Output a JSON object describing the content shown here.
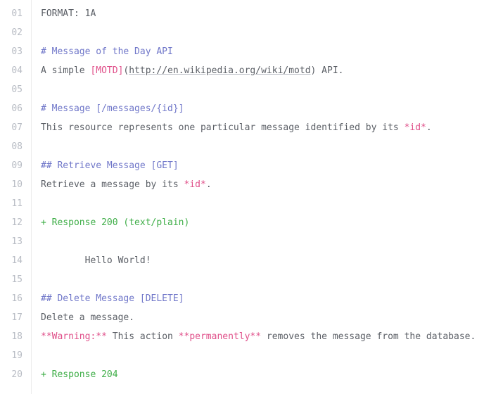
{
  "editor": {
    "lines": [
      {
        "no": "01",
        "spans": [
          {
            "t": "FORMAT: 1A",
            "c": "c-default"
          }
        ]
      },
      {
        "no": "02",
        "spans": []
      },
      {
        "no": "03",
        "spans": [
          {
            "t": "# Message of the Day API",
            "c": "c-heading"
          }
        ]
      },
      {
        "no": "04",
        "spans": [
          {
            "t": "A simple ",
            "c": "c-default"
          },
          {
            "t": "[MOTD]",
            "c": "c-link"
          },
          {
            "t": "(",
            "c": "c-default"
          },
          {
            "t": "http://en.wikipedia.org/wiki/motd",
            "c": "c-url"
          },
          {
            "t": ") API.",
            "c": "c-default"
          }
        ]
      },
      {
        "no": "05",
        "spans": []
      },
      {
        "no": "06",
        "spans": [
          {
            "t": "# Message [/messages/{id}]",
            "c": "c-heading"
          }
        ]
      },
      {
        "no": "07",
        "spans": [
          {
            "t": "This resource represents one particular message identified by its ",
            "c": "c-default"
          },
          {
            "t": "*id*",
            "c": "c-emph"
          },
          {
            "t": ".",
            "c": "c-default"
          }
        ]
      },
      {
        "no": "08",
        "spans": []
      },
      {
        "no": "09",
        "spans": [
          {
            "t": "## Retrieve Message [GET]",
            "c": "c-heading"
          }
        ]
      },
      {
        "no": "10",
        "spans": [
          {
            "t": "Retrieve a message by its ",
            "c": "c-default"
          },
          {
            "t": "*id*",
            "c": "c-emph"
          },
          {
            "t": ".",
            "c": "c-default"
          }
        ]
      },
      {
        "no": "11",
        "spans": []
      },
      {
        "no": "12",
        "spans": [
          {
            "t": "+ Response 200 (text/plain)",
            "c": "c-response"
          }
        ]
      },
      {
        "no": "13",
        "spans": []
      },
      {
        "no": "14",
        "spans": [
          {
            "t": "        Hello World!",
            "c": "c-body"
          }
        ]
      },
      {
        "no": "15",
        "spans": []
      },
      {
        "no": "16",
        "spans": [
          {
            "t": "## Delete Message [DELETE]",
            "c": "c-heading"
          }
        ]
      },
      {
        "no": "17",
        "spans": [
          {
            "t": "Delete a message.",
            "c": "c-default"
          }
        ]
      },
      {
        "no": "18",
        "spans": [
          {
            "t": "**Warning:**",
            "c": "c-emph"
          },
          {
            "t": " This action ",
            "c": "c-default"
          },
          {
            "t": "**permanently**",
            "c": "c-emph"
          },
          {
            "t": " removes the message from the database.",
            "c": "c-default"
          }
        ]
      },
      {
        "no": "19",
        "spans": []
      },
      {
        "no": "20",
        "spans": [
          {
            "t": "+ Response 204",
            "c": "c-response"
          }
        ]
      }
    ]
  },
  "colors": {
    "heading": "#7077c9",
    "link": "#e0508a",
    "response": "#3fae48",
    "text": "#5b5f66",
    "gutter_numbers": "#b8bcc4"
  }
}
